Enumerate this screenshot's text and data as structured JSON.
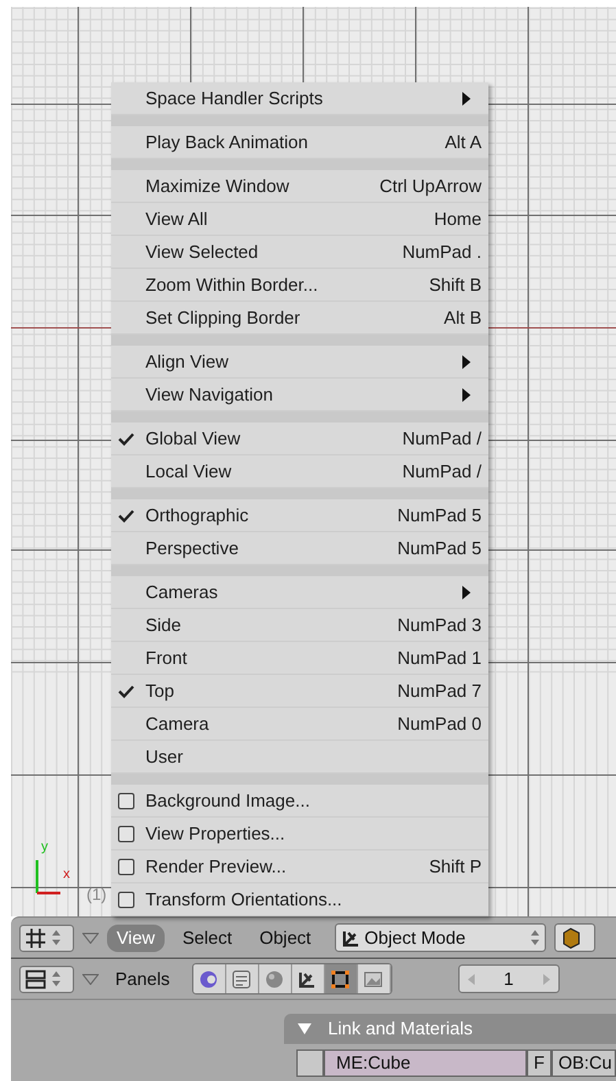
{
  "viewport": {
    "axis_labels": [
      "y",
      "x"
    ],
    "frame_label": "(1)"
  },
  "menu": {
    "groups": [
      [
        {
          "kind": "submenu",
          "label": "Space Handler Scripts"
        }
      ],
      [
        {
          "kind": "plain",
          "label": "Play Back Animation",
          "shortcut": "Alt A"
        }
      ],
      [
        {
          "kind": "plain",
          "label": "Maximize Window",
          "shortcut": "Ctrl UpArrow"
        },
        {
          "kind": "plain",
          "label": "View All",
          "shortcut": "Home"
        },
        {
          "kind": "plain",
          "label": "View Selected",
          "shortcut": "NumPad ."
        },
        {
          "kind": "plain",
          "label": "Zoom Within Border...",
          "shortcut": "Shift B"
        },
        {
          "kind": "plain",
          "label": "Set Clipping Border",
          "shortcut": "Alt B"
        }
      ],
      [
        {
          "kind": "submenu",
          "label": "Align View"
        },
        {
          "kind": "submenu",
          "label": "View Navigation"
        }
      ],
      [
        {
          "kind": "check",
          "label": "Global View",
          "shortcut": "NumPad /",
          "checked": true
        },
        {
          "kind": "check",
          "label": "Local View",
          "shortcut": "NumPad /",
          "checked": false
        }
      ],
      [
        {
          "kind": "check",
          "label": "Orthographic",
          "shortcut": "NumPad 5",
          "checked": true
        },
        {
          "kind": "check",
          "label": "Perspective",
          "shortcut": "NumPad 5",
          "checked": false
        }
      ],
      [
        {
          "kind": "submenu",
          "label": "Cameras"
        },
        {
          "kind": "check",
          "label": "Side",
          "shortcut": "NumPad 3",
          "checked": false
        },
        {
          "kind": "check",
          "label": "Front",
          "shortcut": "NumPad 1",
          "checked": false
        },
        {
          "kind": "check",
          "label": "Top",
          "shortcut": "NumPad 7",
          "checked": true
        },
        {
          "kind": "check",
          "label": "Camera",
          "shortcut": "NumPad 0",
          "checked": false
        },
        {
          "kind": "check",
          "label": "User",
          "checked": false
        }
      ],
      [
        {
          "kind": "toggle",
          "label": "Background Image...",
          "checked": false
        },
        {
          "kind": "toggle",
          "label": "View Properties...",
          "checked": false
        },
        {
          "kind": "toggle",
          "label": "Render Preview...",
          "shortcut": "Shift P",
          "checked": false
        },
        {
          "kind": "toggle",
          "label": "Transform Orientations...",
          "checked": false
        }
      ]
    ]
  },
  "header": {
    "menus": [
      {
        "label": "View",
        "selected": true
      },
      {
        "label": "Select",
        "selected": false
      },
      {
        "label": "Object",
        "selected": false
      }
    ],
    "mode": "Object Mode"
  },
  "buttons_header": {
    "label": "Panels",
    "tabs": [
      {
        "selected": false
      },
      {
        "selected": false
      },
      {
        "selected": false
      },
      {
        "selected": false
      },
      {
        "selected": true
      },
      {
        "selected": false
      }
    ],
    "frame": "1"
  },
  "panel": {
    "title": "Link and Materials",
    "fields": [
      "ME:Cube",
      "F",
      "OB:Cu"
    ]
  }
}
